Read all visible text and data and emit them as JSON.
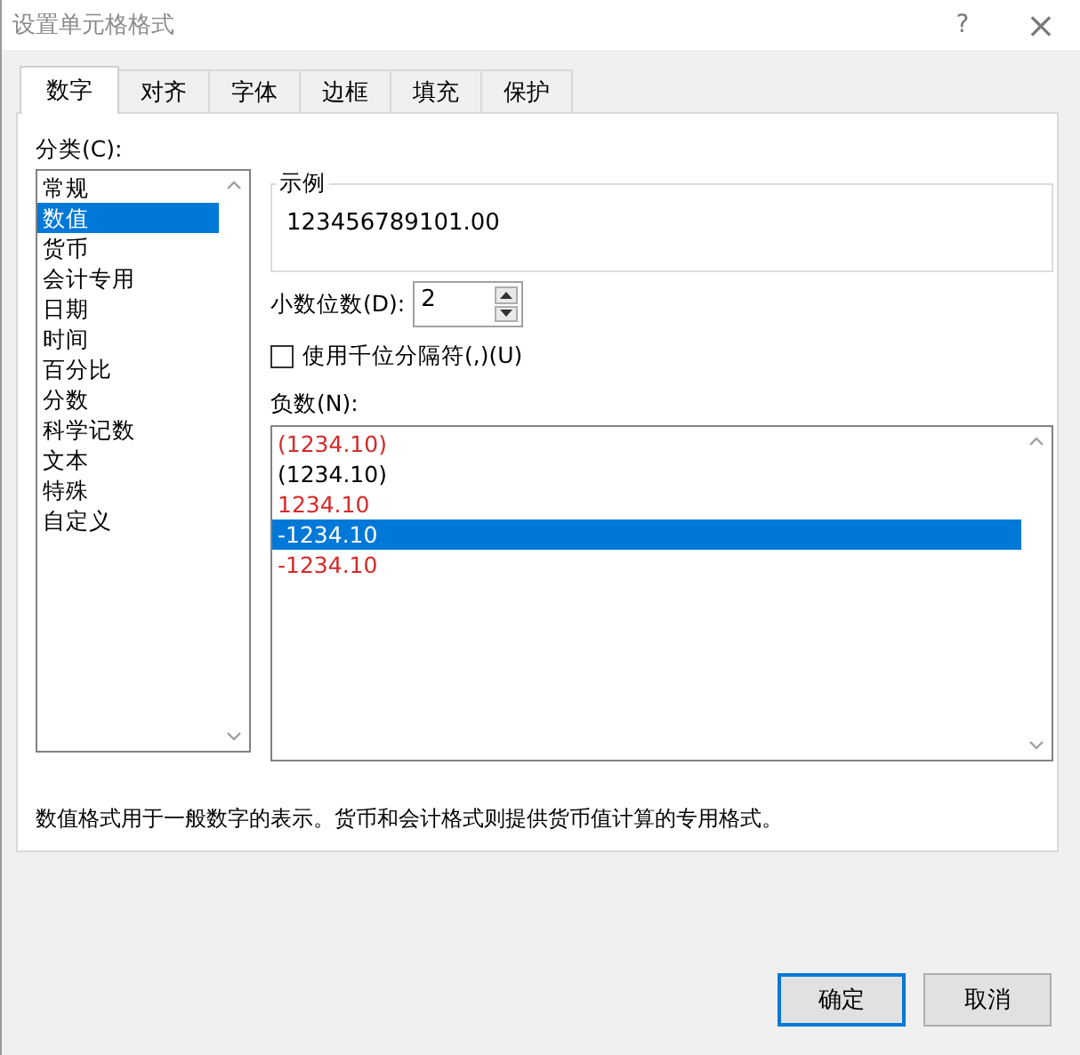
{
  "window": {
    "title": "设置单元格格式",
    "help": "?",
    "close": "×"
  },
  "tabs": [
    {
      "label": "数字",
      "selected": true
    },
    {
      "label": "对齐",
      "selected": false
    },
    {
      "label": "字体",
      "selected": false
    },
    {
      "label": "边框",
      "selected": false
    },
    {
      "label": "填充",
      "selected": false
    },
    {
      "label": "保护",
      "selected": false
    }
  ],
  "category": {
    "label": "分类(C):",
    "items": [
      {
        "label": "常规",
        "selected": false
      },
      {
        "label": "数值",
        "selected": true
      },
      {
        "label": "货币",
        "selected": false
      },
      {
        "label": "会计专用",
        "selected": false
      },
      {
        "label": "日期",
        "selected": false
      },
      {
        "label": "时间",
        "selected": false
      },
      {
        "label": "百分比",
        "selected": false
      },
      {
        "label": "分数",
        "selected": false
      },
      {
        "label": "科学记数",
        "selected": false
      },
      {
        "label": "文本",
        "selected": false
      },
      {
        "label": "特殊",
        "selected": false
      },
      {
        "label": "自定义",
        "selected": false
      }
    ]
  },
  "sample": {
    "title": "示例",
    "value": "123456789101.00"
  },
  "decimal_places": {
    "label": "小数位数(D):",
    "value": "2"
  },
  "thousands_separator": {
    "label": "使用千位分隔符(,)(U)",
    "checked": false
  },
  "negative_numbers": {
    "label": "负数(N):",
    "items": [
      {
        "label": "(1234.10)",
        "color": "#d42a2a",
        "selected": false
      },
      {
        "label": "(1234.10)",
        "color": "#000000",
        "selected": false
      },
      {
        "label": "1234.10",
        "color": "#d42a2a",
        "selected": false
      },
      {
        "label": "-1234.10",
        "selected": true
      },
      {
        "label": "-1234.10",
        "color": "#d42a2a",
        "selected": false
      }
    ]
  },
  "description": "数值格式用于一般数字的表示。货币和会计格式则提供货币值计算的专用格式。",
  "buttons": [
    {
      "label": "确定",
      "kind": "default"
    },
    {
      "label": "取消",
      "kind": "normal"
    }
  ]
}
